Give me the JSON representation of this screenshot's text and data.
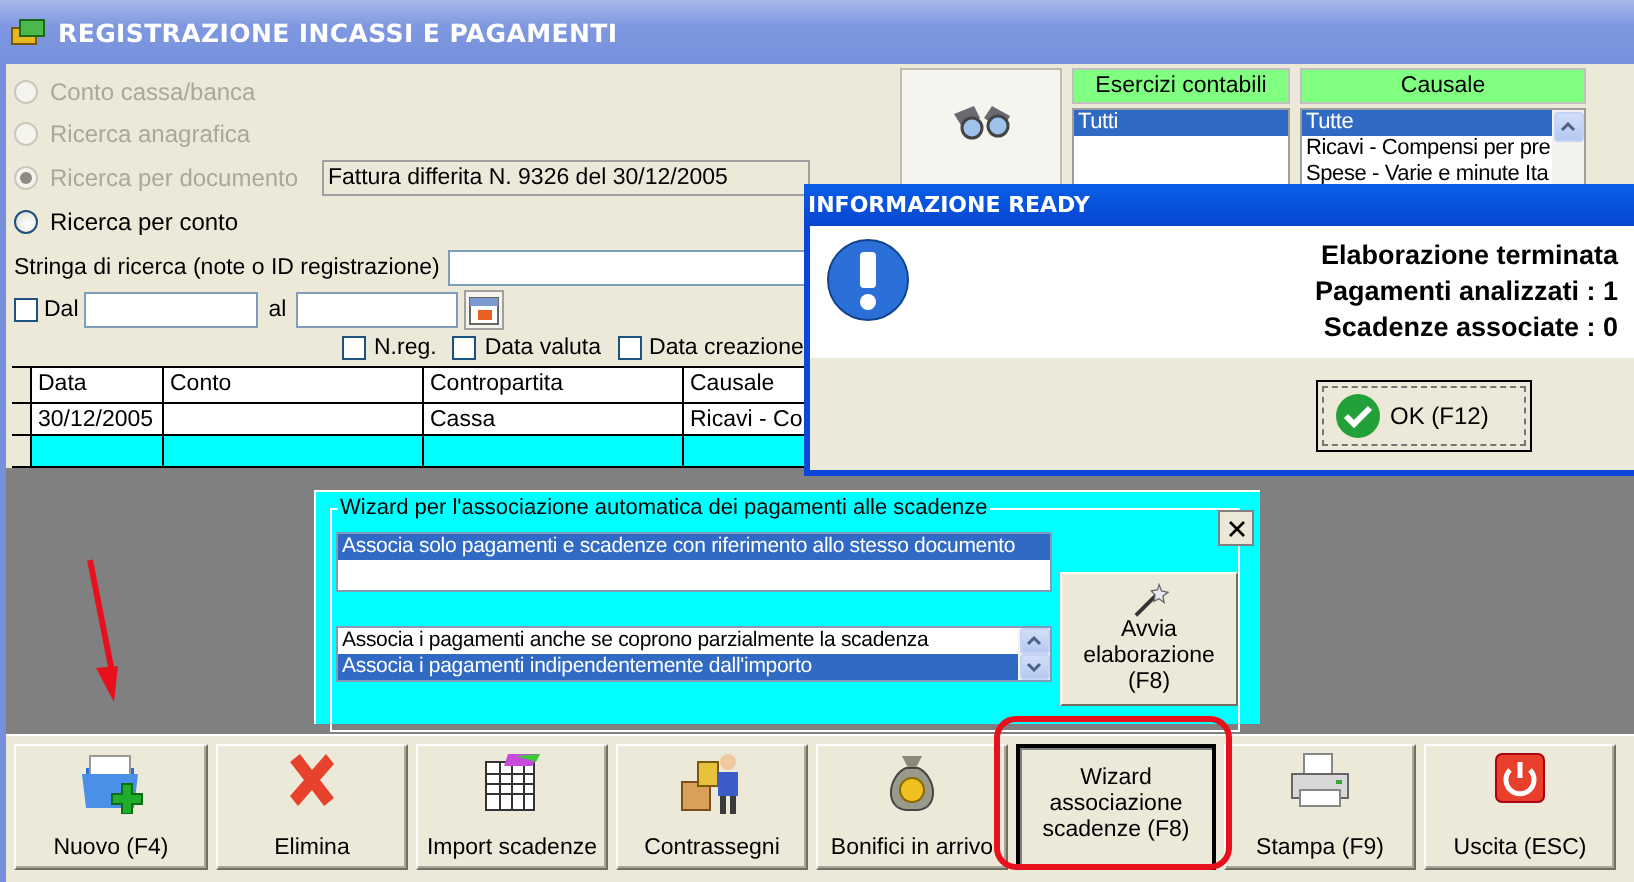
{
  "window": {
    "title": "REGISTRAZIONE INCASSI E PAGAMENTI"
  },
  "search_modes": [
    {
      "label": "Conto cassa/banca",
      "selected": false,
      "disabled": true
    },
    {
      "label": "Ricerca anagrafica",
      "selected": false,
      "disabled": true
    },
    {
      "label": "Ricerca per documento",
      "selected": true,
      "disabled": true
    },
    {
      "label": "Ricerca per conto",
      "selected": false,
      "disabled": false
    }
  ],
  "document_field": {
    "value": "Fattura differita N. 9326 del 30/12/2005"
  },
  "search_string": {
    "label": "Stringa di ricerca (note o ID registrazione)"
  },
  "date_filter": {
    "checked": false,
    "from_label": "Dal",
    "to_label": "al"
  },
  "date_options": [
    {
      "label": "N.reg.",
      "checked": false
    },
    {
      "label": "Data valuta",
      "checked": false
    },
    {
      "label": "Data creazione",
      "checked": false
    }
  ],
  "esercizi": {
    "title": "Esercizi contabili",
    "items": [
      {
        "label": "Tutti",
        "selected": true
      }
    ]
  },
  "causale": {
    "title": "Causale",
    "items": [
      {
        "label": "Tutte",
        "selected": true
      },
      {
        "label": "Ricavi - Compensi per pre",
        "selected": false
      },
      {
        "label": "Spese - Varie e minute Ita",
        "selected": false
      }
    ]
  },
  "table": {
    "columns": [
      "Data",
      "Conto",
      "Contropartita",
      "Causale"
    ],
    "rows": [
      {
        "selected": false,
        "cells": [
          "30/12/2005",
          null,
          "Cassa",
          "Ricavi - Co"
        ]
      },
      {
        "selected": true
      }
    ]
  },
  "wizard": {
    "title": "Wizard per l'associazione automatica dei pagamenti alle scadenze",
    "document_options": [
      {
        "label": "Associa solo pagamenti e scadenze con riferimento allo stesso documento",
        "selected": true
      }
    ],
    "amount_options": [
      {
        "label": "Associa i pagamenti anche se coprono parzialmente la scadenza",
        "selected": false
      },
      {
        "label": "Associa i pagamenti indipendentemente dall'importo",
        "selected": true
      }
    ],
    "start_button": "Avvia elaborazione (F8)"
  },
  "dialog": {
    "title": "INFORMAZIONE READY",
    "lines": [
      "Elaborazione terminata",
      "Pagamenti analizzati : 1",
      "Scadenze associate : 0"
    ],
    "button": "OK (F12)"
  },
  "toolbar": [
    {
      "label": "Nuovo (F4)",
      "kind": "icon",
      "selected": false
    },
    {
      "label": "Elimina",
      "kind": "icon",
      "selected": false
    },
    {
      "label": "Import scadenze",
      "kind": "icon",
      "selected": false
    },
    {
      "label": "Contrassegni",
      "kind": "icon",
      "selected": false
    },
    {
      "label": "Bonifici in arrivo",
      "kind": "icon",
      "selected": false
    },
    {
      "label": "Wizard associazione scadenze (F8)",
      "kind": "text",
      "selected": true
    },
    {
      "label": "Stampa (F9)",
      "kind": "icon",
      "selected": false
    },
    {
      "label": "Uscita (ESC)",
      "kind": "icon",
      "selected": false
    }
  ]
}
